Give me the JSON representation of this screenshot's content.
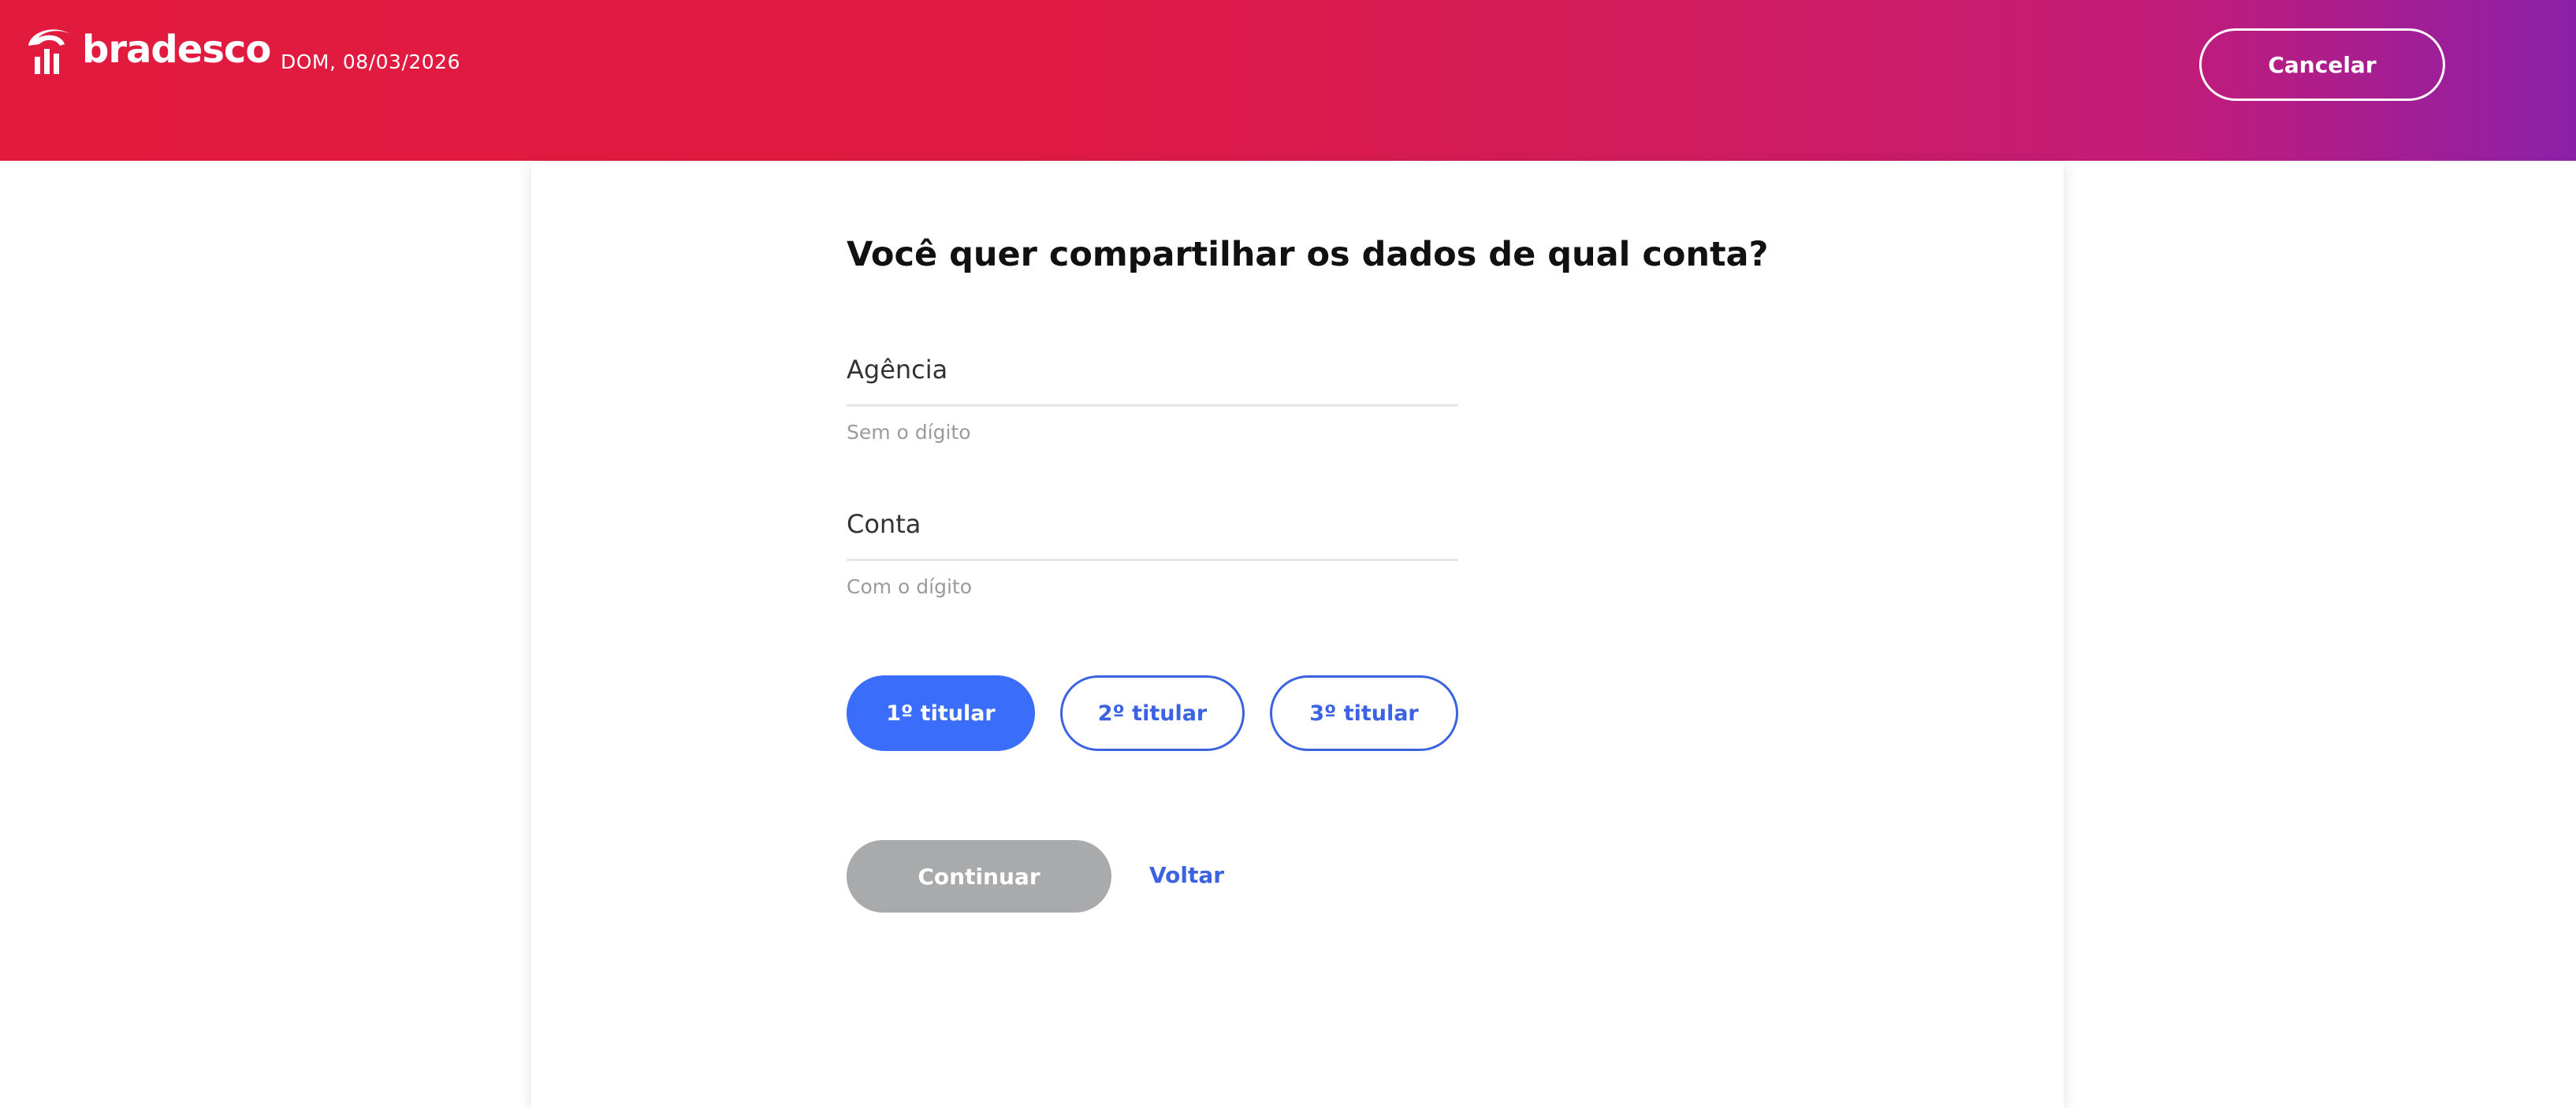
{
  "header": {
    "brand": "bradesco",
    "date": "DOM, 08/03/2026",
    "cancel_label": "Cancelar"
  },
  "main": {
    "title": "Você quer compartilhar os dados de qual conta?",
    "agency": {
      "label": "Agência",
      "value": "",
      "hint": "Sem o dígito"
    },
    "account": {
      "label": "Conta",
      "value": "",
      "hint": "Com o dígito"
    },
    "holders": [
      {
        "label": "1º titular",
        "selected": true
      },
      {
        "label": "2º titular",
        "selected": false
      },
      {
        "label": "3º titular",
        "selected": false
      }
    ],
    "continue_label": "Continuar",
    "back_label": "Voltar"
  },
  "colors": {
    "header_gradient_start": "#e11a3e",
    "header_gradient_end": "#8b20a8",
    "accent_blue": "#3b6dfb",
    "disabled_gray": "#a9aaac"
  },
  "icons": {
    "logo": "bradesco-tree-logo-icon"
  }
}
